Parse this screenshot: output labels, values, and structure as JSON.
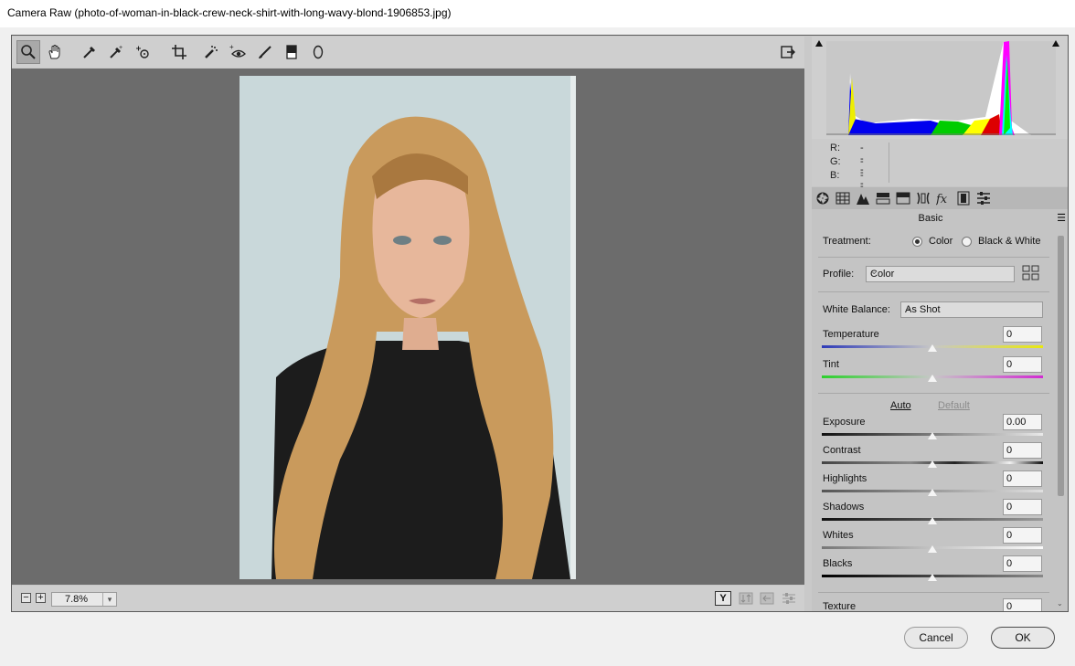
{
  "window": {
    "title": "Camera Raw (photo-of-woman-in-black-crew-neck-shirt-with-long-wavy-blond-1906853.jpg)"
  },
  "toolbar": {
    "tools": [
      "zoom-icon",
      "hand-icon",
      "white-balance-icon",
      "color-sampler-icon",
      "targeted-adjustment-icon",
      "crop-icon",
      "spot-removal-icon",
      "red-eye-icon",
      "adjustment-brush-icon",
      "graduated-filter-icon",
      "radial-filter-icon"
    ],
    "active_tool": "zoom-icon"
  },
  "bottombar": {
    "zoom_minus": "−",
    "zoom_plus": "+",
    "zoom": "7.8%"
  },
  "readout": {
    "r_label": "R:",
    "r_value": "---",
    "g_label": "G:",
    "g_value": "---",
    "b_label": "B:",
    "b_value": "---"
  },
  "panel": {
    "title": "Basic",
    "treatment": {
      "label": "Treatment:",
      "option_color": "Color",
      "option_bw": "Black & White",
      "selected": "Color"
    },
    "profile": {
      "label": "Profile:",
      "value": "Color"
    },
    "white_balance": {
      "label": "White Balance:",
      "value": "As Shot"
    },
    "auto_label": "Auto",
    "default_label": "Default",
    "sliders": [
      {
        "label": "Temperature",
        "value": "0",
        "position": 0.5
      },
      {
        "label": "Tint",
        "value": "0",
        "position": 0.5
      },
      {
        "label": "Exposure",
        "value": "0.00",
        "position": 0.5
      },
      {
        "label": "Contrast",
        "value": "0",
        "position": 0.5
      },
      {
        "label": "Highlights",
        "value": "0",
        "position": 0.5
      },
      {
        "label": "Shadows",
        "value": "0",
        "position": 0.5
      },
      {
        "label": "Whites",
        "value": "0",
        "position": 0.5
      },
      {
        "label": "Blacks",
        "value": "0",
        "position": 0.5
      },
      {
        "label": "Texture",
        "value": "0",
        "position": 0.5
      }
    ]
  },
  "footer": {
    "cancel": "Cancel",
    "ok": "OK"
  }
}
